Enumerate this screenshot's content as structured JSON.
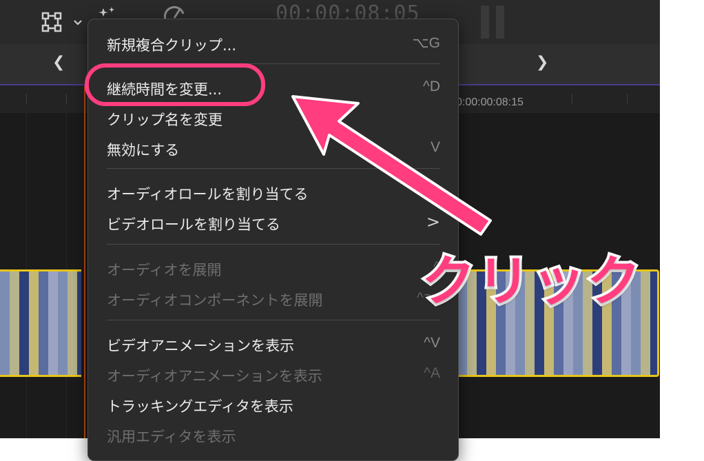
{
  "timeline": {
    "timecode_partial": "00:00:08:05",
    "ruler_label": "0:00:00:08:15"
  },
  "menu": {
    "items": [
      {
        "label": "新規複合クリップ...",
        "shortcut": "⌥G"
      },
      {
        "label": "継続時間を変更...",
        "shortcut": "^D"
      },
      {
        "label": "クリップ名を変更",
        "shortcut": ""
      },
      {
        "label": "無効にする",
        "shortcut": "V"
      },
      {
        "label": "オーディオロールを割り当てる",
        "shortcut": ">"
      },
      {
        "label": "ビデオロールを割り当てる",
        "shortcut": ">"
      },
      {
        "label": "オーディオを展開",
        "shortcut": "^",
        "disabled": true
      },
      {
        "label": "オーディオコンポーネントを展開",
        "shortcut": "^⌥",
        "disabled": true
      },
      {
        "label": "ビデオアニメーションを表示",
        "shortcut": "^V"
      },
      {
        "label": "オーディオアニメーションを表示",
        "shortcut": "^A",
        "disabled": true
      },
      {
        "label": "トラッキングエディタを表示",
        "shortcut": ""
      },
      {
        "label": "汎用エディタを表示",
        "shortcut": "",
        "disabled": true
      }
    ]
  },
  "annotation": {
    "callout_text": "クリック",
    "color": "#ff3d7f"
  }
}
